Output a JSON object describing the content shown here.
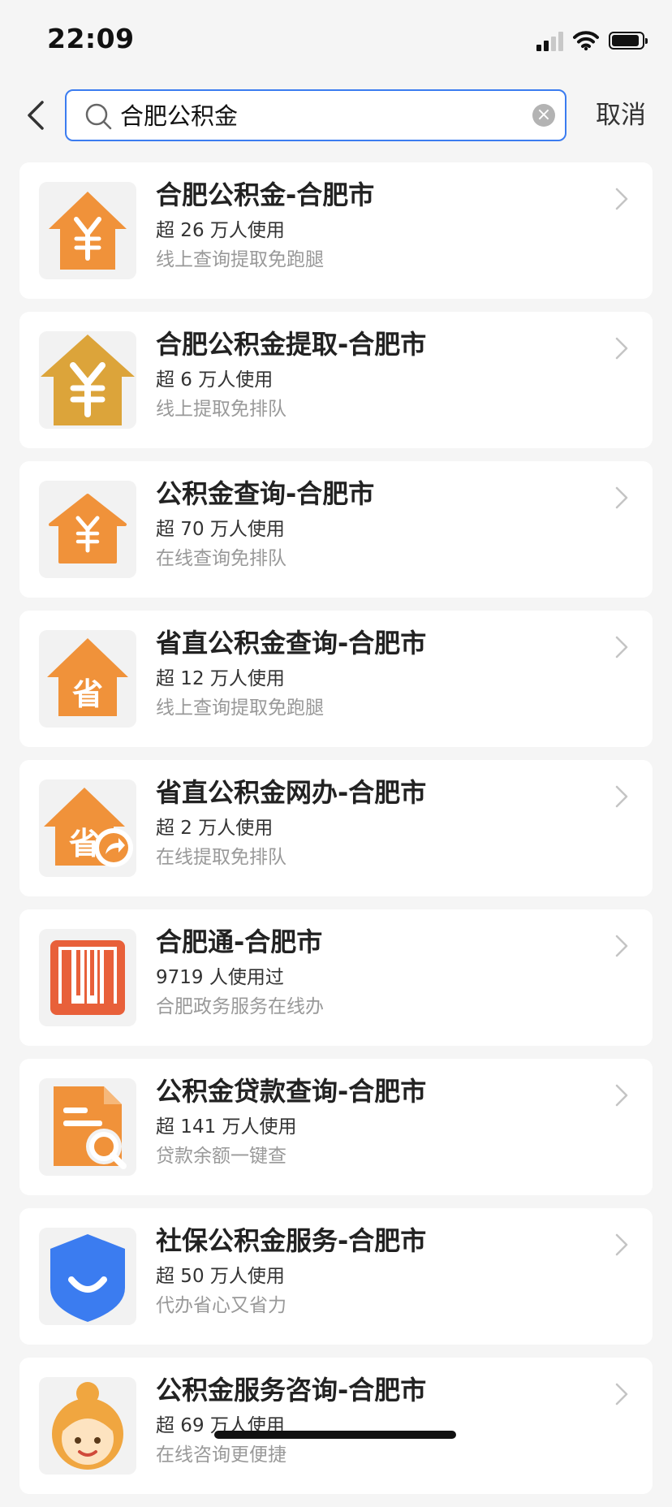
{
  "status_bar": {
    "time": "22:09"
  },
  "search": {
    "query": "合肥公积金",
    "cancel_label": "取消"
  },
  "results": [
    {
      "title": "合肥公积金-合肥市",
      "usage": "超 26 万人使用",
      "desc": "线上查询提取免跑腿",
      "icon": "house-yen-icon",
      "icon_color": "#f0923a",
      "glyph": "¥"
    },
    {
      "title": "合肥公积金提取-合肥市",
      "usage": "超 6 万人使用",
      "desc": "线上提取免排队",
      "icon": "house-yen-icon",
      "icon_color": "#dca43a",
      "glyph": "¥"
    },
    {
      "title": "公积金查询-合肥市",
      "usage": "超 70 万人使用",
      "desc": "在线查询免排队",
      "icon": "house-yen-icon",
      "icon_color": "#f0923a",
      "glyph": "¥"
    },
    {
      "title": "省直公积金查询-合肥市",
      "usage": "超 12 万人使用",
      "desc": "线上查询提取免跑腿",
      "icon": "house-sheng-icon",
      "icon_color": "#f0923a",
      "glyph": "省"
    },
    {
      "title": "省直公积金网办-合肥市",
      "usage": "超 2 万人使用",
      "desc": "在线提取免排队",
      "icon": "house-sheng-share-icon",
      "icon_color": "#f0923a",
      "glyph": "省"
    },
    {
      "title": "合肥通-合肥市",
      "usage": "9719 人使用过",
      "desc": "合肥政务服务在线办",
      "icon": "hefeitong-logo-icon",
      "icon_color": "#e8603a",
      "glyph": ""
    },
    {
      "title": "公积金贷款查询-合肥市",
      "usage": "超 141 万人使用",
      "desc": "贷款余额一键查",
      "icon": "document-search-icon",
      "icon_color": "#f0923a",
      "glyph": ""
    },
    {
      "title": "社保公积金服务-合肥市",
      "usage": "超 50 万人使用",
      "desc": "代办省心又省力",
      "icon": "shield-smile-icon",
      "icon_color": "#3b7cf0",
      "glyph": ""
    },
    {
      "title": "公积金服务咨询-合肥市",
      "usage": "超 69 万人使用",
      "desc": "在线咨询更便捷",
      "icon": "service-agent-icon",
      "icon_color": "#f0a640",
      "glyph": ""
    }
  ]
}
